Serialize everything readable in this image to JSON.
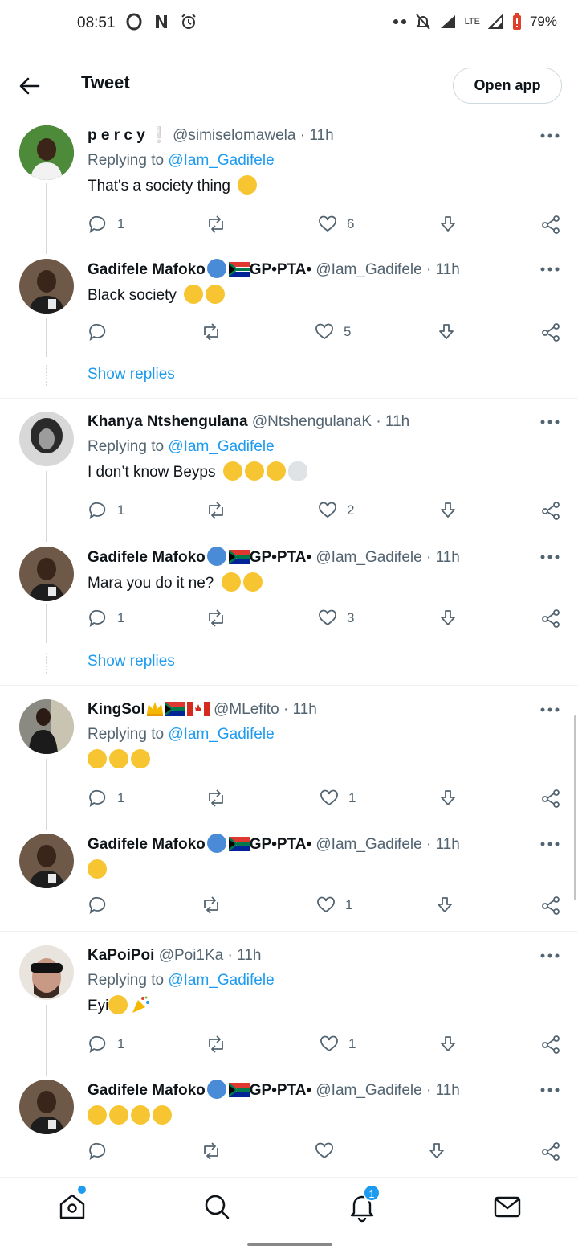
{
  "status_bar": {
    "time": "08:51",
    "battery": "79%",
    "network": "LTE"
  },
  "header": {
    "title": "Tweet",
    "open_app_label": "Open app"
  },
  "tweets": [
    {
      "name": "p e r c y",
      "name_suffix": "❕",
      "handle": "@simiselomawela",
      "time": "11h",
      "replying_prefix": "Replying to",
      "replying_to": "@Iam_Gadifele",
      "text": "That's a society thing",
      "emojis": [
        "sweat-smile"
      ],
      "replies": "1",
      "likes": "6"
    },
    {
      "name": "Gadifele Mafoko",
      "name_suffix": "GP•PTA•",
      "handle": "@Iam_Gadifele",
      "time": "11h",
      "text": "Black society",
      "emojis": [
        "joy",
        "joy"
      ],
      "replies": "",
      "likes": "5"
    },
    {
      "name": "Khanya Ntshengulana",
      "handle": "@NtshengulanaK",
      "time": "11h",
      "replying_prefix": "Replying to",
      "replying_to": "@Iam_Gadifele",
      "text": "I don’t know Beyps",
      "emojis": [
        "loudly-crying",
        "loudly-crying",
        "weary",
        "skull"
      ],
      "replies": "1",
      "likes": "2"
    },
    {
      "name": "Gadifele Mafoko",
      "name_suffix": "GP•PTA•",
      "handle": "@Iam_Gadifele",
      "time": "11h",
      "text": "Mara you do it ne?",
      "emojis": [
        "sweat-smile",
        "sweat-smile"
      ],
      "replies": "1",
      "likes": "3"
    },
    {
      "name": "KingSol",
      "handle": "@MLefito",
      "time": "11h",
      "replying_prefix": "Replying to",
      "replying_to": "@Iam_Gadifele",
      "text": "",
      "emojis": [
        "rofl",
        "rofl",
        "rofl"
      ],
      "replies": "1",
      "likes": "1"
    },
    {
      "name": "Gadifele Mafoko",
      "name_suffix": "GP•PTA•",
      "handle": "@Iam_Gadifele",
      "time": "11h",
      "text": "",
      "emojis": [
        "sweat-smile"
      ],
      "replies": "",
      "likes": "1"
    },
    {
      "name": "KaPoiPoi",
      "handle": "@Poi1Ka",
      "time": "11h",
      "replying_prefix": "Replying to",
      "replying_to": "@Iam_Gadifele",
      "text": "Eyi",
      "emojis": [
        "rofl",
        "party-popper"
      ],
      "replies": "1",
      "likes": "1"
    },
    {
      "name": "Gadifele Mafoko",
      "name_suffix": "GP•PTA•",
      "handle": "@Iam_Gadifele",
      "time": "11h",
      "text": "",
      "emojis": [
        "rofl",
        "rofl",
        "rofl",
        "rofl"
      ],
      "replies": "",
      "likes": ""
    }
  ],
  "show_replies_label": "Show replies",
  "bottom_nav": {
    "notification_count": "1",
    "items": [
      "home-icon",
      "search-icon",
      "notifications-icon",
      "messages-icon"
    ]
  }
}
